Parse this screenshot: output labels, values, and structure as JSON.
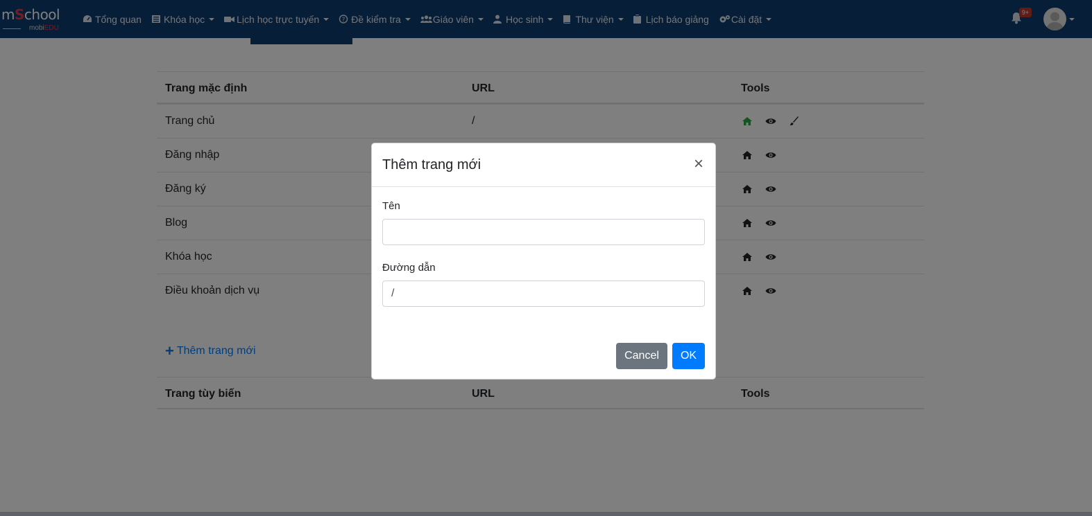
{
  "navbar": {
    "logo": {
      "brand_prefix": "m",
      "brand_s": "S",
      "brand_suffix": "chool",
      "sub_prefix": "mobi",
      "sub_suffix": "EDU"
    },
    "items": [
      {
        "label": "Tổng quan",
        "icon": "dashboard-icon",
        "has_caret": false
      },
      {
        "label": "Khóa học",
        "icon": "list-icon",
        "has_caret": true
      },
      {
        "label": "Lịch học trực tuyến",
        "icon": "video-icon",
        "has_caret": true
      },
      {
        "label": "Đề kiểm tra",
        "icon": "question-icon",
        "has_caret": true
      },
      {
        "label": "Giáo viên",
        "icon": "users-icon",
        "has_caret": true
      },
      {
        "label": "Học sinh",
        "icon": "user-icon",
        "has_caret": true
      },
      {
        "label": "Thư viện",
        "icon": "book-icon",
        "has_caret": true
      },
      {
        "label": "Lịch báo giảng",
        "icon": "clipboard-icon",
        "has_caret": false
      },
      {
        "label": "Cài đặt",
        "icon": "cogs-icon",
        "has_caret": true
      }
    ],
    "notification_badge": "9+"
  },
  "default_pages": {
    "headers": {
      "name": "Trang mặc định",
      "url": "URL",
      "tools": "Tools"
    },
    "rows": [
      {
        "name": "Trang chủ",
        "url": "/",
        "home_active": true,
        "editable": true
      },
      {
        "name": "Đăng nhập",
        "url": "",
        "home_active": false,
        "editable": false
      },
      {
        "name": "Đăng ký",
        "url": "",
        "home_active": false,
        "editable": false
      },
      {
        "name": "Blog",
        "url": "",
        "home_active": false,
        "editable": false
      },
      {
        "name": "Khóa học",
        "url": "",
        "home_active": false,
        "editable": false
      },
      {
        "name": "Điều khoản dịch vụ",
        "url": "",
        "home_active": false,
        "editable": false
      }
    ]
  },
  "add_page_link": "Thêm trang mới",
  "custom_pages": {
    "headers": {
      "name": "Trang tùy biến",
      "url": "URL",
      "tools": "Tools"
    }
  },
  "modal": {
    "title": "Thêm trang mới",
    "close_glyph": "×",
    "name_label": "Tên",
    "name_value": "",
    "path_label": "Đường dẫn",
    "path_value": "/",
    "cancel_label": "Cancel",
    "ok_label": "OK"
  },
  "colors": {
    "navbar": "#0d3c6e",
    "primary": "#007bff",
    "secondary": "#6c757d",
    "home_active": "#28a745",
    "badge": "#c0392b"
  }
}
